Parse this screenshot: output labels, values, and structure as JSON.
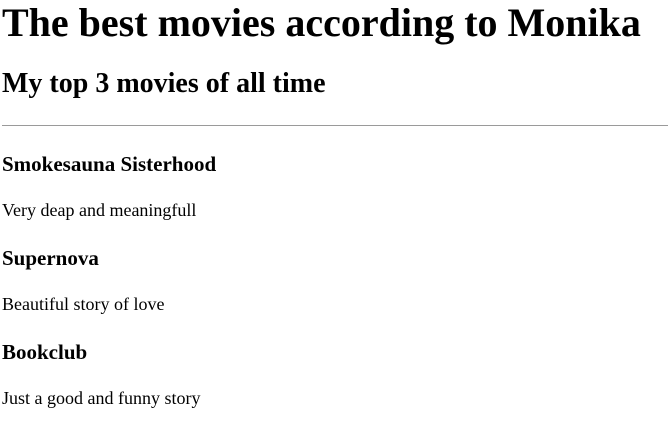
{
  "header": {
    "title": "The best movies according to Monika",
    "subtitle": "My top 3 movies of all time"
  },
  "movies": [
    {
      "title": "Smokesauna Sisterhood",
      "description": "Very deap and meaningfull"
    },
    {
      "title": "Supernova",
      "description": "Beautiful story of love"
    },
    {
      "title": "Bookclub",
      "description": "Just a good and funny story"
    }
  ]
}
